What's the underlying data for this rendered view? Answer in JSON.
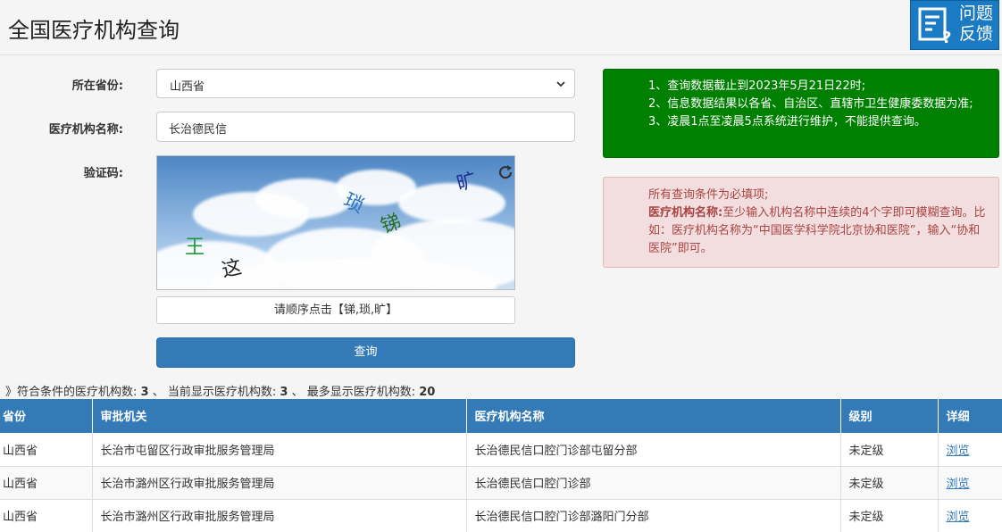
{
  "header": {
    "title": "全国医疗机构查询",
    "feedback_line1": "问题",
    "feedback_line2": "反馈"
  },
  "form": {
    "province_label": "所在省份:",
    "province_value": "山西省",
    "name_label": "医疗机构名称:",
    "name_value": "长治德民信",
    "captcha_label": "验证码:",
    "captcha_chars": [
      "王",
      "这",
      "琐",
      "锑",
      "旷"
    ],
    "captcha_hint": "请顺序点击【锑,琐,旷】",
    "query_label": "查询"
  },
  "notices": {
    "green": [
      "1、查询数据截止到2023年5月21日22时;",
      "2、信息数据结果以各省、自治区、直辖市卫生健康委数据为准;",
      "3、凌晨1点至凌晨5点系统进行维护，不能提供查询。"
    ],
    "red_line1": "所有查询条件为必填项;",
    "red_bold": "医疗机构名称:",
    "red_rest": "至少输入机构名称中连续的4个字即可模糊查询。比如：医疗机构名称为“中国医学科学院北京协和医院”，输入“协和医院”即可。"
  },
  "summary": {
    "prefix": "》符合条件的医疗机构数:",
    "match_count": "3",
    "sep1": "、 当前显示医疗机构数:",
    "shown_count": "3",
    "sep2": "、 最多显示医疗机构数:",
    "max_count": "20"
  },
  "table": {
    "headers": [
      "省份",
      "审批机关",
      "医疗机构名称",
      "级别",
      "详细"
    ],
    "rows": [
      [
        "山西省",
        "长治市屯留区行政审批服务管理局",
        "长治德民信口腔门诊部屯留分部",
        "未定级",
        "浏览"
      ],
      [
        "山西省",
        "长治市潞州区行政审批服务管理局",
        "长治德民信口腔门诊部",
        "未定级",
        "浏览"
      ],
      [
        "山西省",
        "长治市潞州区行政审批服务管理局",
        "长治德民信口腔门诊部潞阳门分部",
        "未定级",
        "浏览"
      ]
    ]
  },
  "colors": {
    "primary": "#337ab7",
    "notice_green": "#008000",
    "notice_red_bg": "#f2dede",
    "notice_red_text": "#a94442",
    "feedback_bg": "#1a7ac4"
  },
  "icons": {
    "feedback": "feedback-form-icon",
    "select": "chevron-down-icon",
    "captcha_refresh": "refresh-icon"
  }
}
